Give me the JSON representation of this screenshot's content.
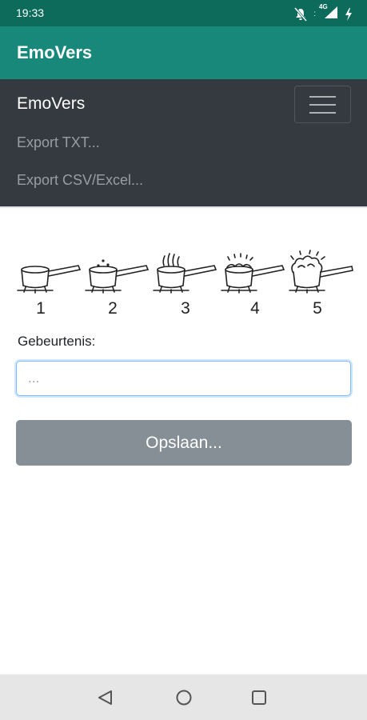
{
  "status_bar": {
    "time": "19:33",
    "network": "4G"
  },
  "app_bar": {
    "title": "EmoVers"
  },
  "navbar": {
    "brand": "EmoVers",
    "links": [
      "Export TXT...",
      "Export CSV/Excel..."
    ]
  },
  "scale": {
    "levels": [
      "1",
      "2",
      "3",
      "4",
      "5"
    ]
  },
  "form": {
    "label": "Gebeurtenis:",
    "input_placeholder": "...",
    "input_value": "",
    "save_label": "Opslaan..."
  },
  "colors": {
    "status_bar": "#0d6b5c",
    "app_bar": "#17887a",
    "navbar": "#343a40",
    "button": "#868e96",
    "input_focus": "#80bdff"
  },
  "icons": [
    "mute-icon",
    "signal-icon",
    "charging-icon",
    "menu-icon",
    "back-icon",
    "home-icon",
    "recents-icon"
  ]
}
